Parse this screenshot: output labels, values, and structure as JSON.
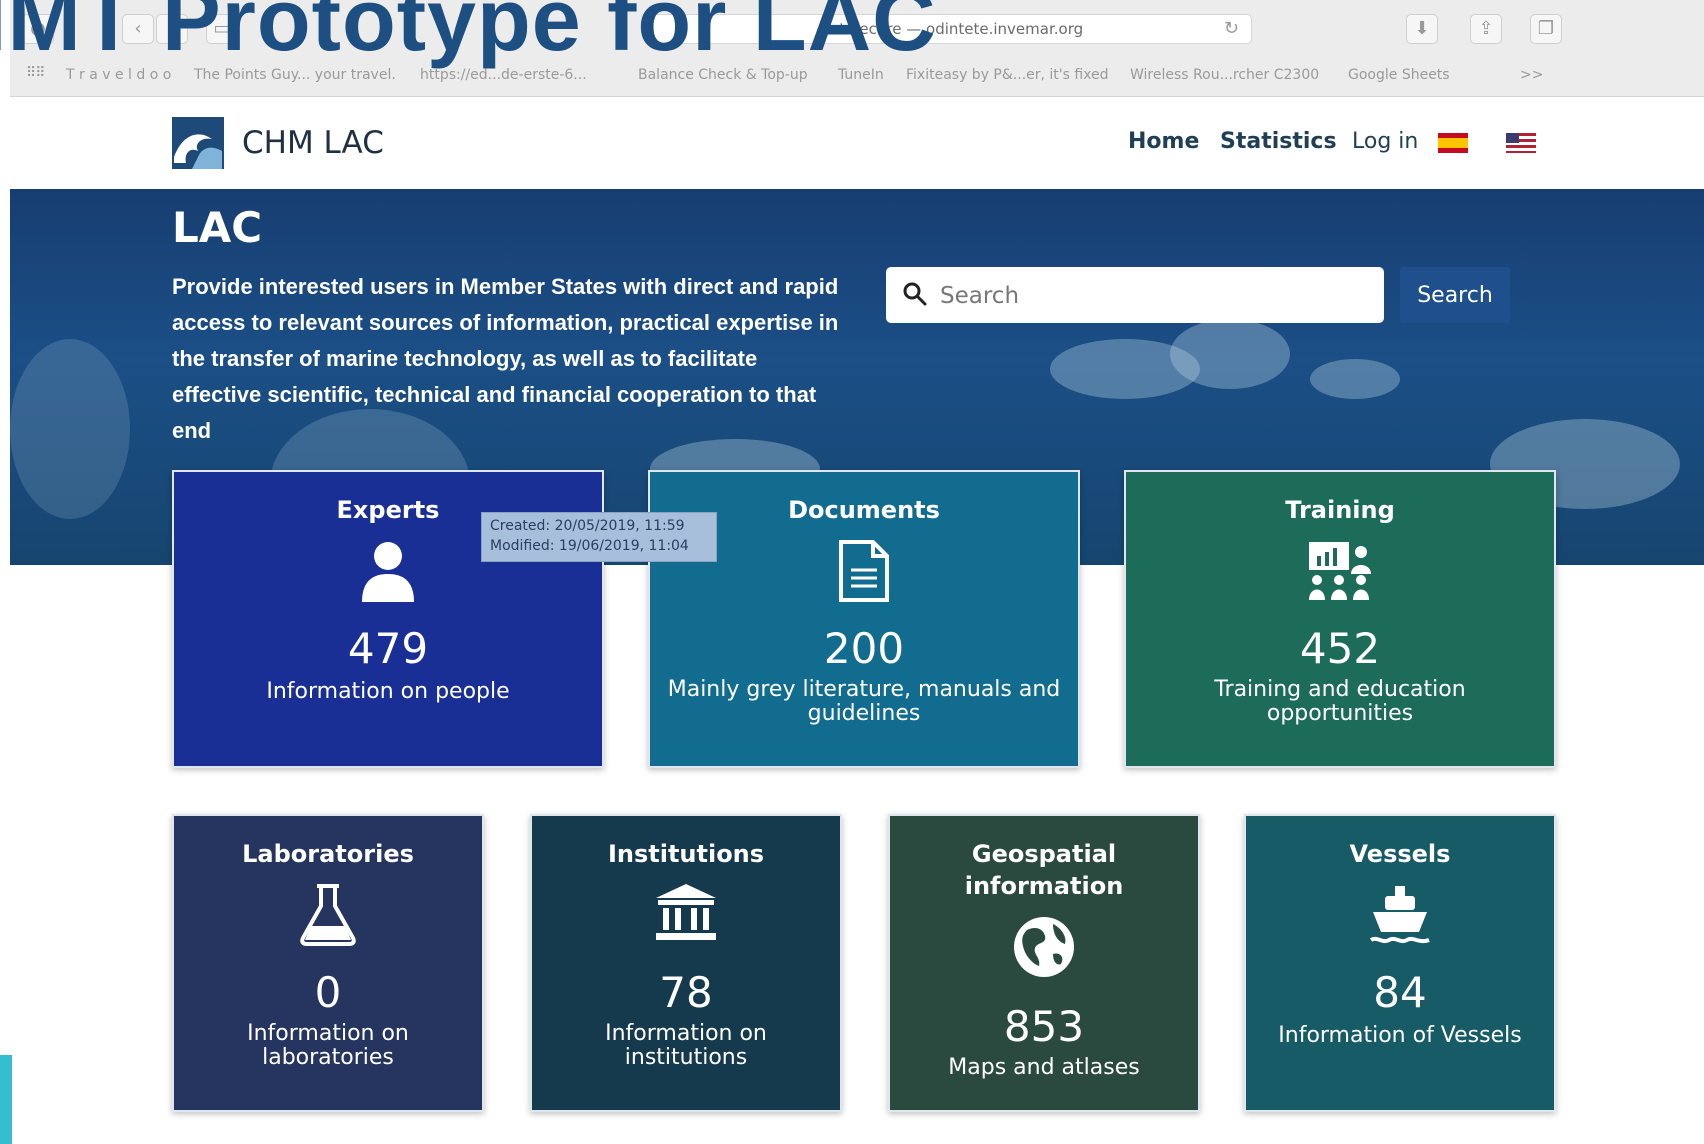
{
  "slide": {
    "title": "IMT Prototype for LAC"
  },
  "browser": {
    "url_text": "Not Secure — odintete.invemar.org",
    "bookmarks": [
      "T r a v e l d o o",
      "The Points Guy... your travel.",
      "https://ed...de-erste-6...",
      "Balance Check & Top-up",
      "TuneIn",
      "Fixiteasy by P&...er, it's fixed",
      "Wireless Rou...rcher C2300",
      "Google Sheets"
    ],
    "overflow_label": ">>"
  },
  "header": {
    "brand": "CHM LAC",
    "nav": {
      "home": "Home",
      "statistics": "Statistics",
      "login": "Log in"
    },
    "flags": [
      "spanish-flag",
      "us-flag"
    ]
  },
  "hero": {
    "title": "LAC",
    "description": "Provide interested users in Member States with direct and rapid access to relevant sources of information, practical expertise in the transfer of marine technology, as well as to facilitate effective scientific, technical and financial cooperation to that end",
    "search": {
      "placeholder": "Search",
      "button_label": "Search"
    }
  },
  "tooltip": {
    "created": "Created: 20/05/2019, 11:59",
    "modified": "Modified: 19/06/2019, 11:04"
  },
  "cards": {
    "experts": {
      "title": "Experts",
      "count": "479",
      "description": "Information on people",
      "icon": "person-icon",
      "color": "#1a2f96"
    },
    "documents": {
      "title": "Documents",
      "count": "200",
      "description": "Mainly grey literature, manuals and guidelines",
      "icon": "document-icon",
      "color": "#126c8f"
    },
    "training": {
      "title": "Training",
      "count": "452",
      "description": "Training and education opportunities",
      "icon": "training-icon",
      "color": "#1d6c5a"
    },
    "laboratories": {
      "title": "Laboratories",
      "count": "0",
      "description": "Information on laboratories",
      "icon": "flask-icon",
      "color": "#26355f"
    },
    "institutions": {
      "title": "Institutions",
      "count": "78",
      "description": "Information on institutions",
      "icon": "institution-icon",
      "color": "#163a4d"
    },
    "geospatial": {
      "title": "Geospatial information",
      "count": "853",
      "description": "Maps and atlases",
      "icon": "globe-icon",
      "color": "#2b4a3f"
    },
    "vessels": {
      "title": "Vessels",
      "count": "84",
      "description": "Information of Vessels",
      "icon": "ship-icon",
      "color": "#165b66"
    }
  }
}
